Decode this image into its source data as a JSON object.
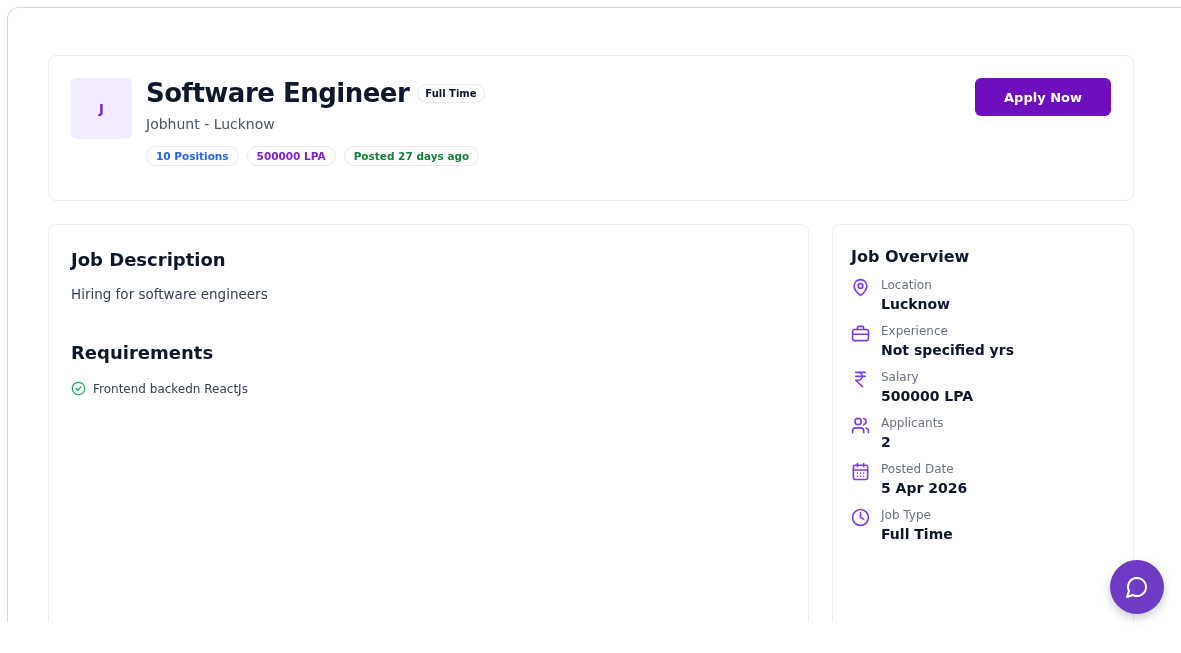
{
  "header": {
    "logo_letter": "J",
    "title": "Software Engineer",
    "job_type_badge": "Full Time",
    "company_location": "Jobhunt - Lucknow",
    "tags": [
      {
        "label": "10 Positions",
        "color": "#2563eb"
      },
      {
        "label": "500000 LPA",
        "color": "#7e22ce"
      },
      {
        "label": "Posted 27 days ago",
        "color": "#15803d"
      }
    ],
    "apply_button": "Apply Now"
  },
  "description": {
    "heading": "Job Description",
    "text": "Hiring for software engineers",
    "requirements_heading": "Requirements",
    "requirements": [
      "Frontend backedn ReactJs"
    ]
  },
  "overview": {
    "heading": "Job Overview",
    "items": [
      {
        "kind": "location",
        "label": "Location",
        "value": "Lucknow"
      },
      {
        "kind": "experience",
        "label": "Experience",
        "value": "Not specified yrs"
      },
      {
        "kind": "salary",
        "label": "Salary",
        "value": "500000 LPA"
      },
      {
        "kind": "applicants",
        "label": "Applicants",
        "value": "2"
      },
      {
        "kind": "date",
        "label": "Posted Date",
        "value": "5 Apr 2026"
      },
      {
        "kind": "type",
        "label": "Job Type",
        "value": "Full Time"
      }
    ]
  }
}
